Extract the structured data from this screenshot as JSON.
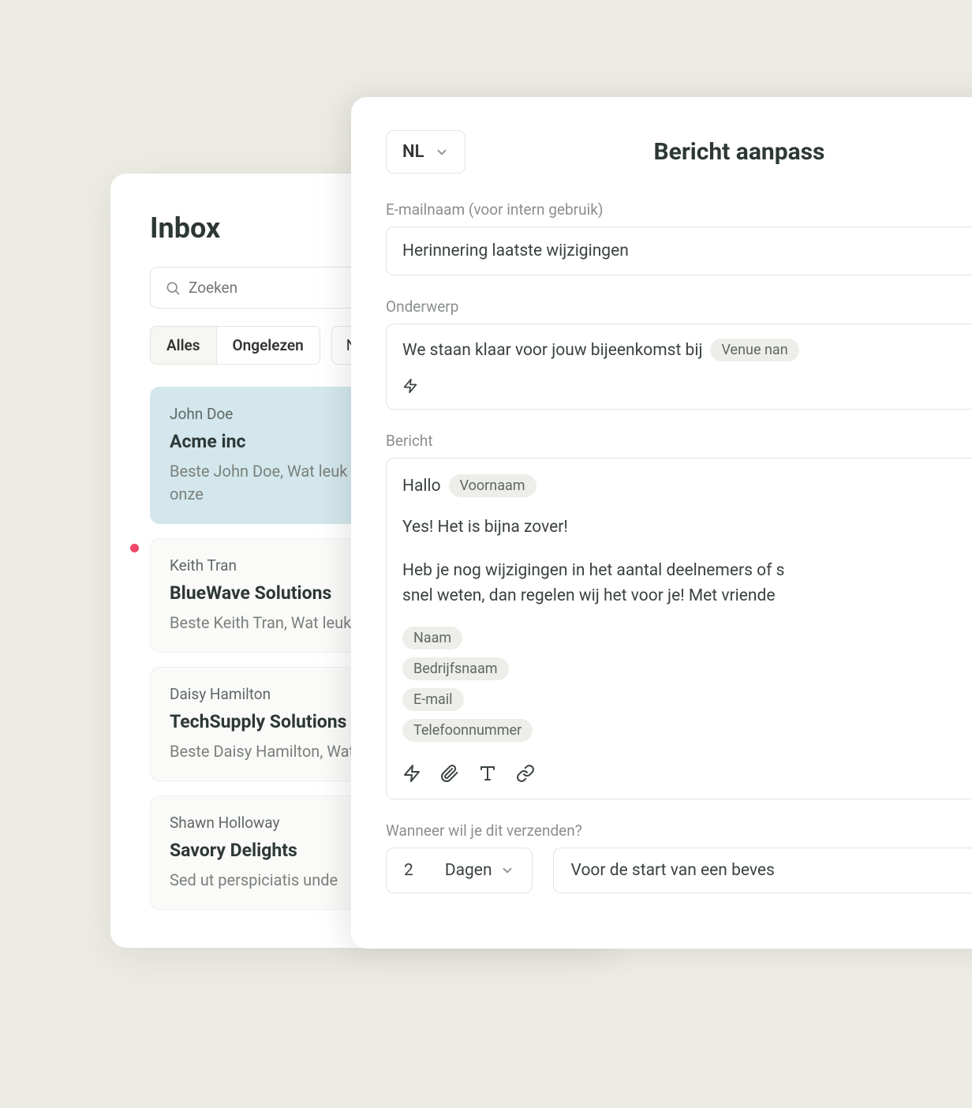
{
  "inbox": {
    "title": "Inbox",
    "search_placeholder": "Zoeken",
    "tabs": {
      "all": "Alles",
      "unread": "Ongelezen",
      "extra": "Nie"
    },
    "messages": [
      {
        "sender": "John Doe",
        "subject": "Acme inc",
        "preview": "Beste John Doe, Wat leuk dat u heeft gekozen voor onze",
        "selected": true,
        "unread": false
      },
      {
        "sender": "Keith Tran",
        "subject": "BlueWave Solutions",
        "preview": "Beste Keith Tran, Wat leuk dat u heeft gekozen voor o",
        "selected": false,
        "unread": true
      },
      {
        "sender": "Daisy Hamilton",
        "subject": "TechSupply Solutions",
        "preview": "Beste Daisy Hamilton, Wat leuk dat u heeft gekozen vo",
        "selected": false,
        "unread": false
      },
      {
        "sender": "Shawn Holloway",
        "subject": "Savory Delights",
        "preview": "Sed ut perspiciatis unde",
        "selected": false,
        "unread": false
      }
    ]
  },
  "editor": {
    "language": "NL",
    "title": "Bericht aanpass",
    "email_name_label": "E-mailnaam (voor intern gebruik)",
    "email_name_value": "Herinnering laatste wijzigingen",
    "subject_label": "Onderwerp",
    "subject_text": "We staan klaar voor jouw bijeenkomst bij",
    "subject_token": "Venue nan",
    "message_label": "Bericht",
    "greeting": "Hallo",
    "greeting_token": "Voornaam",
    "body_line1": "Yes! Het is bijna zover!",
    "body_line2": "Heb je nog wijzigingen in het aantal deelnemers of s\nsnel weten, dan regelen wij het voor je! Met vriende",
    "tokens": [
      "Naam",
      "Bedrijfsnaam",
      "E-mail",
      "Telefoonnummer"
    ],
    "when_label": "Wanneer wil je dit verzenden?",
    "qty": "2",
    "unit": "Dagen",
    "trigger": "Voor de start van een beves"
  }
}
